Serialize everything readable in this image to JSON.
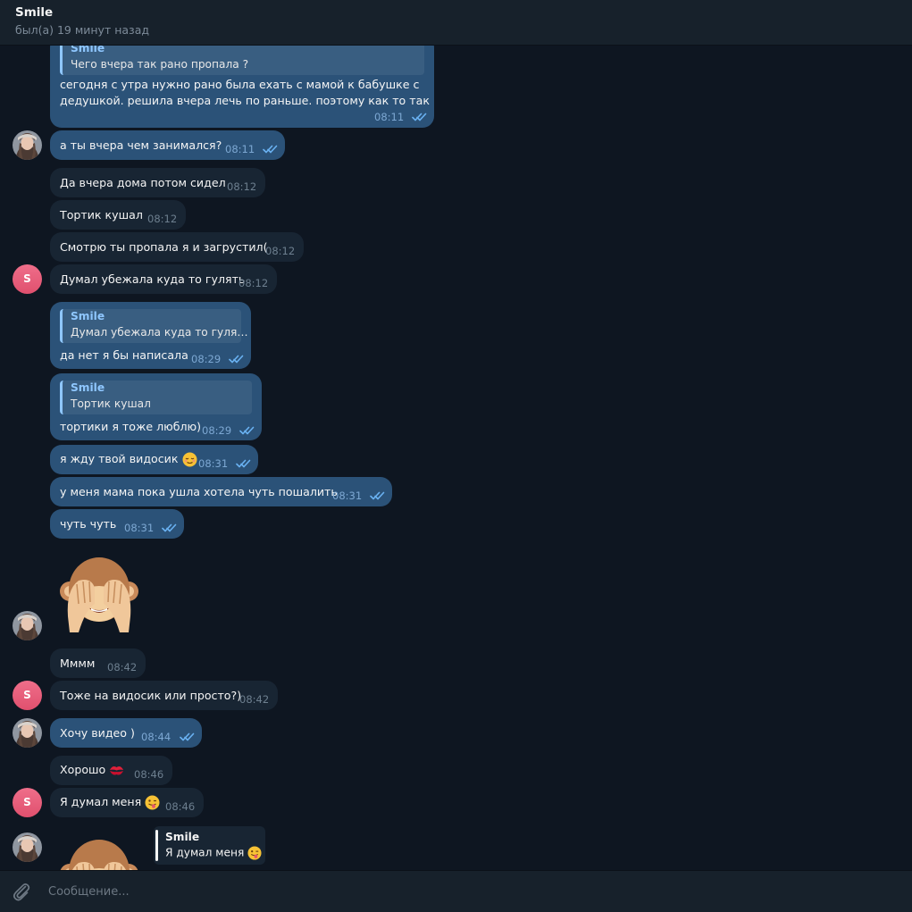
{
  "header": {
    "title": "Smile",
    "status": "был(а) 19 минут назад"
  },
  "messages": [
    {
      "reply_name": "Smile",
      "reply_text": "Чего вчера так рано пропала ?",
      "line1": "сегодня с утра нужно рано была ехать с мамой к бабушке с",
      "line2": "дедушкой. решила вчера лечь по раньше. поэтому как то так",
      "time": "08:11"
    },
    {
      "text": "а ты вчера чем занимался?",
      "time": "08:11"
    },
    {
      "text": "Да вчера дома потом сидел",
      "time": "08:12"
    },
    {
      "text": "Тортик кушал",
      "time": "08:12"
    },
    {
      "text": "Смотрю ты пропала я и загрустил(",
      "time": "08:12"
    },
    {
      "text": "Думал убежала куда то гулять",
      "time": "08:12"
    },
    {
      "reply_name": "Smile",
      "reply_text": "Думал убежала куда то гуля…",
      "text": "да нет я бы написала",
      "time": "08:29"
    },
    {
      "reply_name": "Smile",
      "reply_text": "Тортик кушал",
      "text": "тортики я тоже люблю)",
      "time": "08:29"
    },
    {
      "text": "я жду твой видосик",
      "time": "08:31"
    },
    {
      "text": "у меня мама пока ушла хотела чуть пошалить",
      "time": "08:31"
    },
    {
      "text": "чуть чуть",
      "time": "08:31"
    },
    {
      "text": "Мммм",
      "time": "08:42"
    },
    {
      "text": "Тоже на видосик или просто?)",
      "time": "08:42"
    },
    {
      "text": "Хочу видео )",
      "time": "08:44"
    },
    {
      "text": "Хорошо",
      "time": "08:46"
    },
    {
      "text": "Я думал меня",
      "time": "08:46"
    },
    {
      "reply_name": "Smile",
      "reply_text": "Я думал меня"
    }
  ],
  "avatars": {
    "letter": "S"
  },
  "composer": {
    "placeholder": "Сообщение..."
  },
  "colors": {
    "background": "#0e1621",
    "incoming": "#182533",
    "outgoing": "#2b5278",
    "accent": "#6ab2f2"
  },
  "icons": [
    "double-check-icon",
    "attach-icon",
    "monkey-see-no-evil-sticker",
    "relieved-face-emoji",
    "kiss-mark-emoji",
    "winking-tongue-emoji"
  ]
}
